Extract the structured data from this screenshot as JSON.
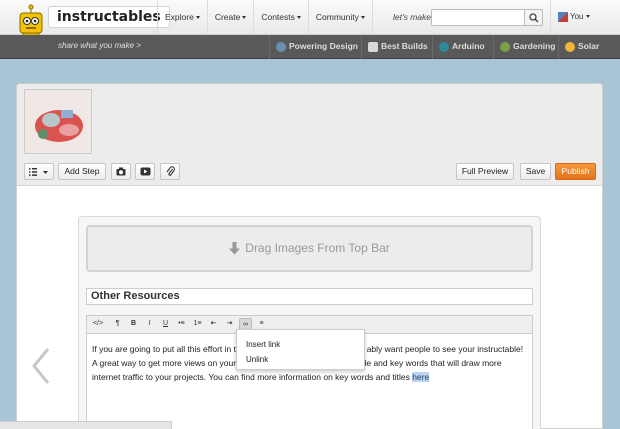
{
  "site": {
    "logo": "instructables",
    "tagline": "share what you make >"
  },
  "nav": {
    "items": [
      {
        "label": "Explore"
      },
      {
        "label": "Create"
      },
      {
        "label": "Contests"
      },
      {
        "label": "Community"
      }
    ],
    "lets_make": "let's make",
    "search_placeholder": "",
    "user_label": "You"
  },
  "channels": [
    {
      "label": "Powering Design",
      "color": "#6a8fb5"
    },
    {
      "label": "Best Builds",
      "color": "#d9d9d9"
    },
    {
      "label": "Arduino",
      "color": "#2a8a9a"
    },
    {
      "label": "Gardening",
      "color": "#7aa04a"
    },
    {
      "label": "Solar",
      "color": "#f2b53a"
    }
  ],
  "editor": {
    "add_step": "Add Step",
    "full_preview": "Full Preview",
    "save": "Save",
    "publish": "Publish",
    "dropzone": "Drag Images From Top Bar",
    "step_title": "Other Resources",
    "toolbar": [
      "</>",
      "¶",
      "B",
      "I",
      "U",
      "•≡",
      "1≡",
      "⇤",
      "⇥",
      "∞",
      "≡"
    ],
    "body_lines": [
      "If you are going to put all this effort in to",
      "ably want people to see your instructable!",
      " A great way to get more views on your",
      "tle and key words that will draw more",
      "internet traffic to your projects.  You can find more information on key words and titles",
      "here"
    ],
    "link_menu": [
      "Insert link",
      "Unlink"
    ]
  },
  "colors": {
    "publish": "#ee7d22",
    "accent_selection": "#bcd4f0"
  }
}
